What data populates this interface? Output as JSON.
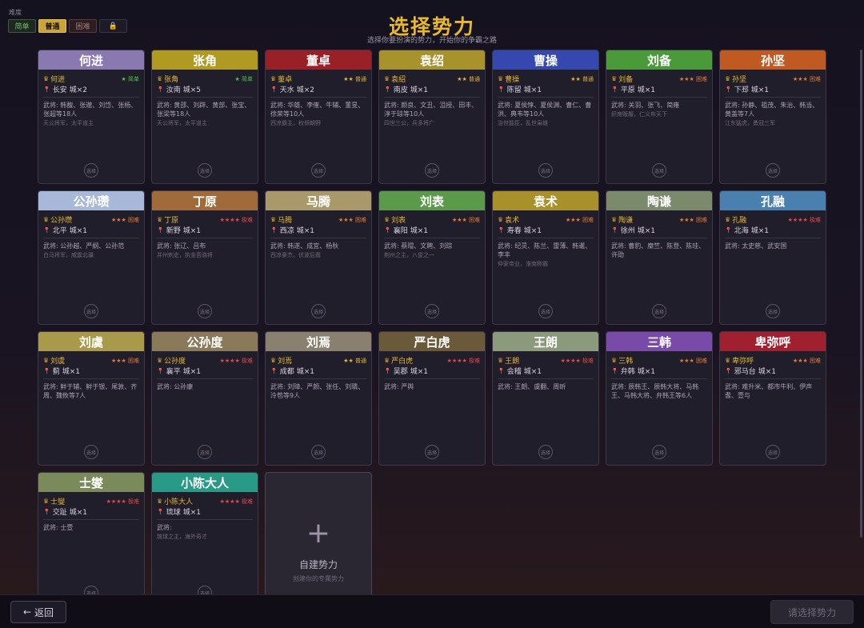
{
  "difficulty": {
    "label": "难度",
    "options": [
      "简单",
      "普通",
      "困难",
      "🔒"
    ]
  },
  "header": {
    "title": "选择势力",
    "subtitle": "选择你要扮演的势力，开始你的争霸之路"
  },
  "select_label": "选择",
  "colors": {
    "easy": "#4cc24a",
    "normal": "#e0b43a",
    "hard": "#e07a3a",
    "extreme": "#e04848"
  },
  "factions": [
    {
      "name": "何进",
      "color": "#8a78b0",
      "ruler": "何进",
      "stars": "★",
      "level": "简单",
      "lvl": "easy",
      "capital": "长安",
      "cities": "城×2",
      "generals": "武将: 韩馥、张邈、刘岱、张杨、张超等18人",
      "desc": "天公将军，太平道主"
    },
    {
      "name": "张角",
      "color": "#b09a22",
      "ruler": "张角",
      "stars": "★",
      "level": "简单",
      "lvl": "easy",
      "capital": "汝南",
      "cities": "城×5",
      "generals": "武将: 黄邵、刘辟、黄部、张宝、张梁等18人",
      "desc": "天公将军，太平道主"
    },
    {
      "name": "董卓",
      "color": "#9a2028",
      "ruler": "董卓",
      "stars": "★★",
      "level": "普通",
      "lvl": "normal",
      "capital": "天水",
      "cities": "城×2",
      "generals": "武将: 华雄、李傕、牛辅、董旻、徐荣等10人",
      "desc": "西凉霸主，权倾朝野"
    },
    {
      "name": "袁绍",
      "color": "#a8922c",
      "ruler": "袁绍",
      "stars": "★★",
      "level": "普通",
      "lvl": "normal",
      "capital": "南皮",
      "cities": "城×1",
      "generals": "武将: 颜良、文丑、沮授、田丰、淳于琼等10人",
      "desc": "四世三公，兵多将广"
    },
    {
      "name": "曹操",
      "color": "#3448b0",
      "ruler": "曹操",
      "stars": "★★",
      "level": "普通",
      "lvl": "normal",
      "capital": "陈留",
      "cities": "城×1",
      "generals": "武将: 夏侯惇、夏侯渊、曹仁、曹洪、典韦等10人",
      "desc": "治世能臣，乱世枭雄"
    },
    {
      "name": "刘备",
      "color": "#4a9a3a",
      "ruler": "刘备",
      "stars": "★★★",
      "level": "困难",
      "lvl": "hard",
      "capital": "平原",
      "cities": "城×1",
      "generals": "武将: 关羽、张飞、简雍",
      "desc": "织席贩履，仁义布天下"
    },
    {
      "name": "孙坚",
      "color": "#c05a22",
      "ruler": "孙坚",
      "stars": "★★★",
      "level": "困难",
      "lvl": "hard",
      "capital": "下邳",
      "cities": "城×1",
      "generals": "武将: 孙静、祖茂、朱治、韩当、黄盖等7人",
      "desc": "江东猛虎，勇冠三军"
    },
    {
      "name": "公孙瓒",
      "color": "#a8b8d8",
      "ruler": "公孙瓒",
      "stars": "★★★",
      "level": "困难",
      "lvl": "hard",
      "capital": "北平",
      "cities": "城×1",
      "generals": "武将: 公孙越、严纲、公孙范",
      "desc": "白马将军，威震北疆"
    },
    {
      "name": "丁原",
      "color": "#a06a3a",
      "ruler": "丁原",
      "stars": "★★★★",
      "level": "极难",
      "lvl": "extreme",
      "capital": "新野",
      "cities": "城×1",
      "generals": "武将: 张辽、吕布",
      "desc": "并州刺史，执金吾骁将"
    },
    {
      "name": "马腾",
      "color": "#a8986a",
      "ruler": "马腾",
      "stars": "★★★",
      "level": "困难",
      "lvl": "hard",
      "capital": "西凉",
      "cities": "城×1",
      "generals": "武将: 韩遂、成宜、杨秋",
      "desc": "西凉豪杰，伏波后裔"
    },
    {
      "name": "刘表",
      "color": "#5a9a4a",
      "ruler": "刘表",
      "stars": "★★★",
      "level": "困难",
      "lvl": "hard",
      "capital": "襄阳",
      "cities": "城×1",
      "generals": "武将: 蔡瑁、文聘、刘琮",
      "desc": "荆州之主，八俊之一"
    },
    {
      "name": "袁术",
      "color": "#a8902a",
      "ruler": "袁术",
      "stars": "★★★",
      "level": "困难",
      "lvl": "hard",
      "capital": "寿春",
      "cities": "城×1",
      "generals": "武将: 纪灵、陈兰、雷薄、韩暹、李丰",
      "desc": "仲家帝业，淮南称霸"
    },
    {
      "name": "陶谦",
      "color": "#7a8a6a",
      "ruler": "陶谦",
      "stars": "★★★",
      "level": "困难",
      "lvl": "hard",
      "capital": "徐州",
      "cities": "城×1",
      "generals": "武将: 曹豹、糜竺、陈登、陈珪、许劭",
      "desc": ""
    },
    {
      "name": "孔融",
      "color": "#4a80b0",
      "ruler": "孔融",
      "stars": "★★★★",
      "level": "极难",
      "lvl": "extreme",
      "capital": "北海",
      "cities": "城×1",
      "generals": "武将: 太史慈、武安国",
      "desc": ""
    },
    {
      "name": "刘虞",
      "color": "#a89a4a",
      "ruler": "刘虞",
      "stars": "★★★",
      "level": "困难",
      "lvl": "hard",
      "capital": "蓟",
      "cities": "城×1",
      "generals": "武将: 鲜于辅、鲜于银、尾敦、齐周、魏攸等7人",
      "desc": ""
    },
    {
      "name": "公孙度",
      "color": "#8a7a5a",
      "ruler": "公孙度",
      "stars": "★★★★",
      "level": "极难",
      "lvl": "extreme",
      "capital": "襄平",
      "cities": "城×1",
      "generals": "武将: 公孙康",
      "desc": ""
    },
    {
      "name": "刘焉",
      "color": "#8a8070",
      "ruler": "刘焉",
      "stars": "★★",
      "level": "普通",
      "lvl": "normal",
      "capital": "成都",
      "cities": "城×1",
      "generals": "武将: 刘璋、严颜、张任、刘璝、泠苞等9人",
      "desc": ""
    },
    {
      "name": "严白虎",
      "color": "#6a5a3a",
      "ruler": "严白虎",
      "stars": "★★★★",
      "level": "极难",
      "lvl": "extreme",
      "capital": "吴郡",
      "cities": "城×1",
      "generals": "武将: 严舆",
      "desc": ""
    },
    {
      "name": "王朗",
      "color": "#8a9a7a",
      "ruler": "王朗",
      "stars": "★★★★",
      "level": "极难",
      "lvl": "extreme",
      "capital": "会稽",
      "cities": "城×1",
      "generals": "武将: 王朗、虞翻、周昕",
      "desc": ""
    },
    {
      "name": "三韩",
      "color": "#7a4aa8",
      "ruler": "三韩",
      "stars": "★★★",
      "level": "困难",
      "lvl": "hard",
      "capital": "弁韩",
      "cities": "城×1",
      "generals": "武将: 辰韩王、辰韩大将、马韩王、马韩大将、弁韩王等6人",
      "desc": ""
    },
    {
      "name": "卑弥呼",
      "color": "#a02030",
      "ruler": "卑弥呼",
      "stars": "★★★",
      "level": "困难",
      "lvl": "hard",
      "capital": "邪马台",
      "cities": "城×1",
      "generals": "武将: 难升米、都市牛利、伊声耆、壹与",
      "desc": ""
    },
    {
      "name": "士燮",
      "color": "#7a8a5a",
      "ruler": "士燮",
      "stars": "★★★★",
      "level": "极难",
      "lvl": "extreme",
      "capital": "交趾",
      "cities": "城×1",
      "generals": "武将: 士壹",
      "desc": ""
    },
    {
      "name": "小陈大人",
      "color": "#2a9a88",
      "ruler": "小陈大人",
      "stars": "★★★★",
      "level": "极难",
      "lvl": "extreme",
      "capital": "琉球",
      "cities": "城×1",
      "generals": "武将:",
      "desc": "琉球之主，海外奇才"
    }
  ],
  "custom": {
    "plus": "+",
    "title": "自建势力",
    "subtitle": "创建你的专属势力"
  },
  "footer": {
    "back_arrow": "←",
    "back_label": "返回",
    "confirm_label": "请选择势力"
  }
}
